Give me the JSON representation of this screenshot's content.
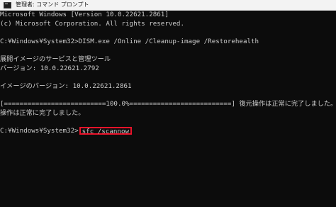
{
  "window": {
    "title": "管理者: コマンド プロンプト",
    "icon": "cmd-icon"
  },
  "console": {
    "lines": [
      "Microsoft Windows [Version 10.0.22621.2861]",
      "(c) Microsoft Corporation. All rights reserved.",
      "",
      "C:¥Windows¥System32>DISM.exe /Online /Cleanup-image /Restorehealth",
      "",
      "展開イメージのサービスと管理ツール",
      "バージョン: 10.0.22621.2792",
      "",
      "イメージのバージョン: 10.0.22621.2861",
      "",
      "[==========================100.0%==========================] 復元操作は正常に完了しました。",
      "操作は正常に完了しました。",
      ""
    ],
    "current_prompt": "C:¥Windows¥System32>",
    "current_command": "sfc /scannow"
  },
  "colors": {
    "background": "#0c0c0c",
    "text": "#cccccc",
    "highlight_box": "#e8132a",
    "titlebar": "#f3f3f3"
  }
}
